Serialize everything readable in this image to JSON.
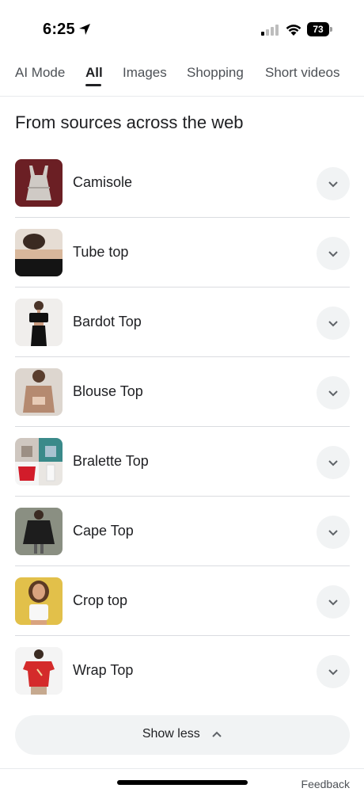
{
  "status_bar": {
    "time": "6:25",
    "battery": "73"
  },
  "tabs": [
    {
      "label": "AI Mode",
      "active": false
    },
    {
      "label": "All",
      "active": true
    },
    {
      "label": "Images",
      "active": false
    },
    {
      "label": "Shopping",
      "active": false
    },
    {
      "label": "Short videos",
      "active": false
    }
  ],
  "section": {
    "heading": "From sources across the web"
  },
  "items": [
    {
      "label": "Camisole"
    },
    {
      "label": "Tube top"
    },
    {
      "label": "Bardot Top"
    },
    {
      "label": "Blouse Top"
    },
    {
      "label": "Bralette Top"
    },
    {
      "label": "Cape Top"
    },
    {
      "label": "Crop top"
    },
    {
      "label": "Wrap Top"
    }
  ],
  "show_less": {
    "label": "Show less"
  },
  "footer": {
    "feedback": "Feedback"
  },
  "colors": {
    "accent": "#202124",
    "chip_bg": "#f1f3f4",
    "divider": "#dadce0"
  }
}
